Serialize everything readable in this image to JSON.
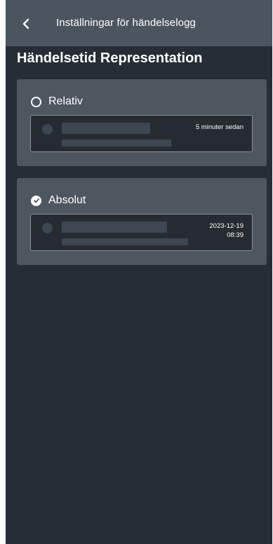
{
  "header": {
    "back_icon": "chevron-left-icon",
    "title": "Inställningar för händelselogg"
  },
  "section": {
    "title": "Händelsetid Representation"
  },
  "options": [
    {
      "label": "Relativ",
      "selected": false,
      "preview_time": [
        "5 minuter sedan"
      ]
    },
    {
      "label": "Absolut",
      "selected": true,
      "preview_time": [
        "2023-12-19",
        "08:39"
      ]
    }
  ],
  "colors": {
    "header_bg": "#4b5560",
    "page_bg": "#262d36",
    "card_bg": "#4e5660",
    "preview_bg": "#262b31",
    "placeholder": "#3c4752",
    "text": "#ffffff"
  }
}
